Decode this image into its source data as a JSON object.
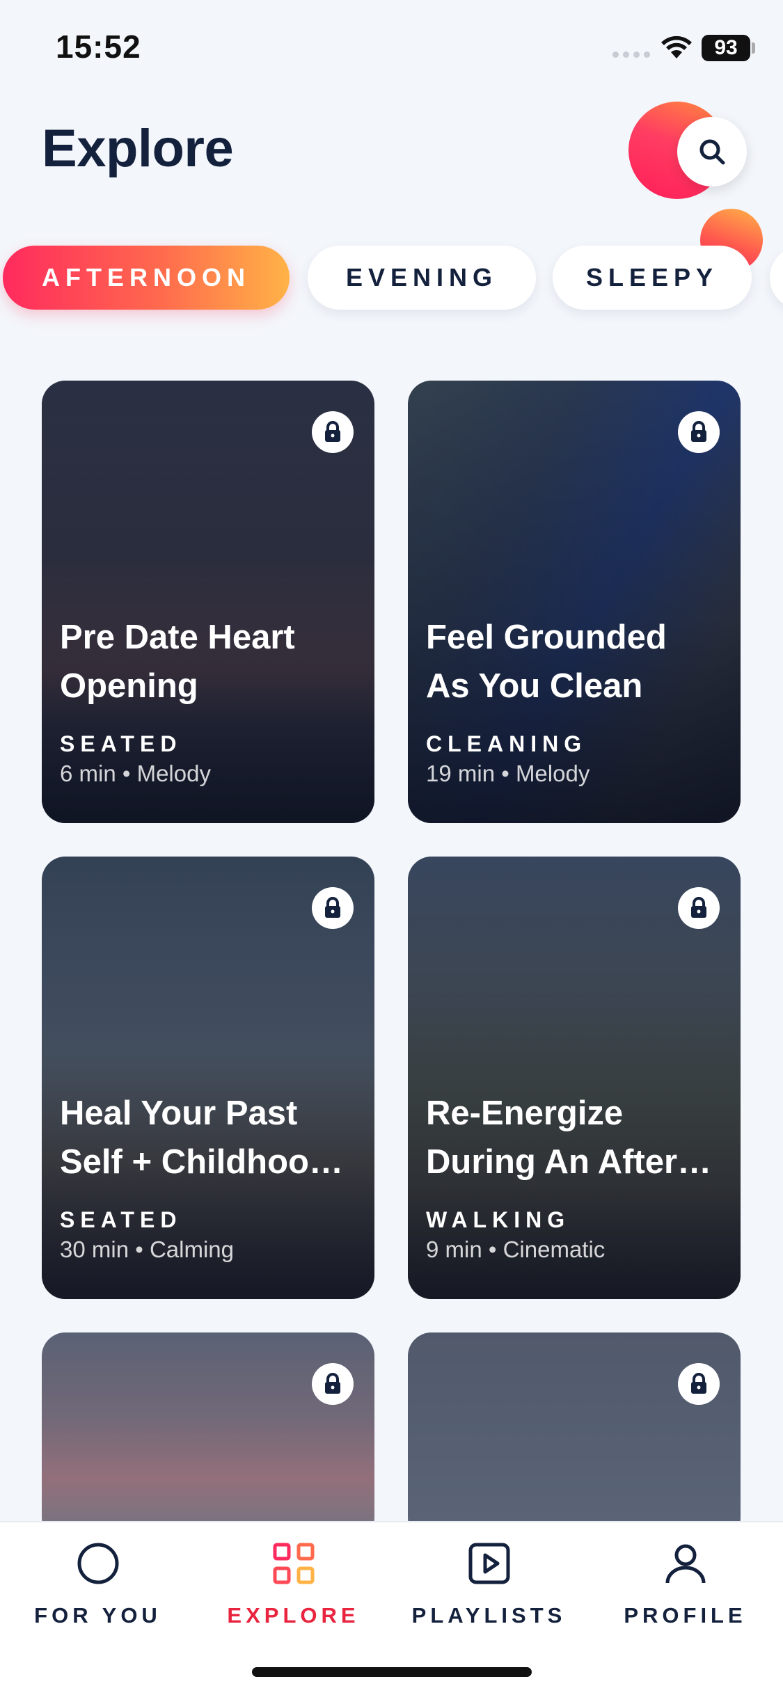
{
  "status_bar": {
    "time": "15:52",
    "battery": "93"
  },
  "header": {
    "title": "Explore"
  },
  "filters": [
    {
      "label": "AFTERNOON",
      "active": true
    },
    {
      "label": "EVENING",
      "active": false
    },
    {
      "label": "SLEEPY",
      "active": false
    }
  ],
  "cards": [
    {
      "title_line1": "Pre Date Heart",
      "title_line2": "Opening",
      "category": "SEATED",
      "meta": "6 min • Melody",
      "locked": true
    },
    {
      "title_line1": "Feel Grounded",
      "title_line2": "As You Clean",
      "category": "CLEANING",
      "meta": "19 min • Melody",
      "locked": true
    },
    {
      "title_line1": "Heal Your Past",
      "title_line2": "Self + Childhoo…",
      "category": "SEATED",
      "meta": "30 min • Calming",
      "locked": true
    },
    {
      "title_line1": "Re-Energize",
      "title_line2": "During An After…",
      "category": "WALKING",
      "meta": "9 min • Cinematic",
      "locked": true
    },
    {
      "locked": true
    },
    {
      "locked": true
    }
  ],
  "tab_bar": {
    "tabs": [
      {
        "label": "FOR YOU",
        "icon": "circle-icon",
        "active": false
      },
      {
        "label": "EXPLORE",
        "icon": "grid-icon",
        "active": true
      },
      {
        "label": "PLAYLISTS",
        "icon": "play-square-icon",
        "active": false
      },
      {
        "label": "PROFILE",
        "icon": "person-icon",
        "active": false
      }
    ]
  },
  "colors": {
    "accent": "#e8243f",
    "gradient_start": "#ff2a5e",
    "gradient_end": "#ffb347",
    "text_dark": "#14213d",
    "background": "#f3f6fb"
  }
}
